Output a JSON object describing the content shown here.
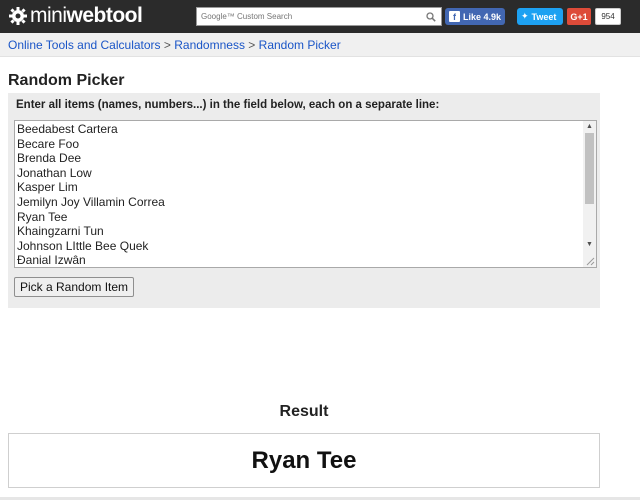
{
  "header": {
    "logo_prefix": "mini",
    "logo_bold": "webtool",
    "search_placeholder": "Google™ Custom Search",
    "fb_like_label": "Like 4.9k",
    "tweet_label": "Tweet",
    "gplus_label": "G+1",
    "gplus_count": "954",
    "colors": {
      "bar": "#2b2b2b",
      "facebook": "#4267b2",
      "twitter": "#1da1f2",
      "gplus": "#dd4b39"
    }
  },
  "breadcrumb": {
    "items": [
      "Online Tools and Calculators",
      "Randomness",
      "Random Picker"
    ],
    "separator": ">"
  },
  "page": {
    "title": "Random Picker",
    "instruction": "Enter all items (names, numbers...) in the field below, each on a separate line:",
    "items": [
      "Beedabest Cartera",
      "Becare Foo",
      "Brenda Dee",
      "Jonathan Low",
      "Kasper Lim",
      "Jemilyn Joy Villamin Correa",
      "Ryan Tee",
      "Khaingzarni Tun",
      "Johnson LIttle Bee Quek",
      "Đanial Izwân"
    ],
    "pick_button": "Pick a Random Item"
  },
  "result": {
    "label": "Result",
    "value": "Ryan Tee"
  }
}
